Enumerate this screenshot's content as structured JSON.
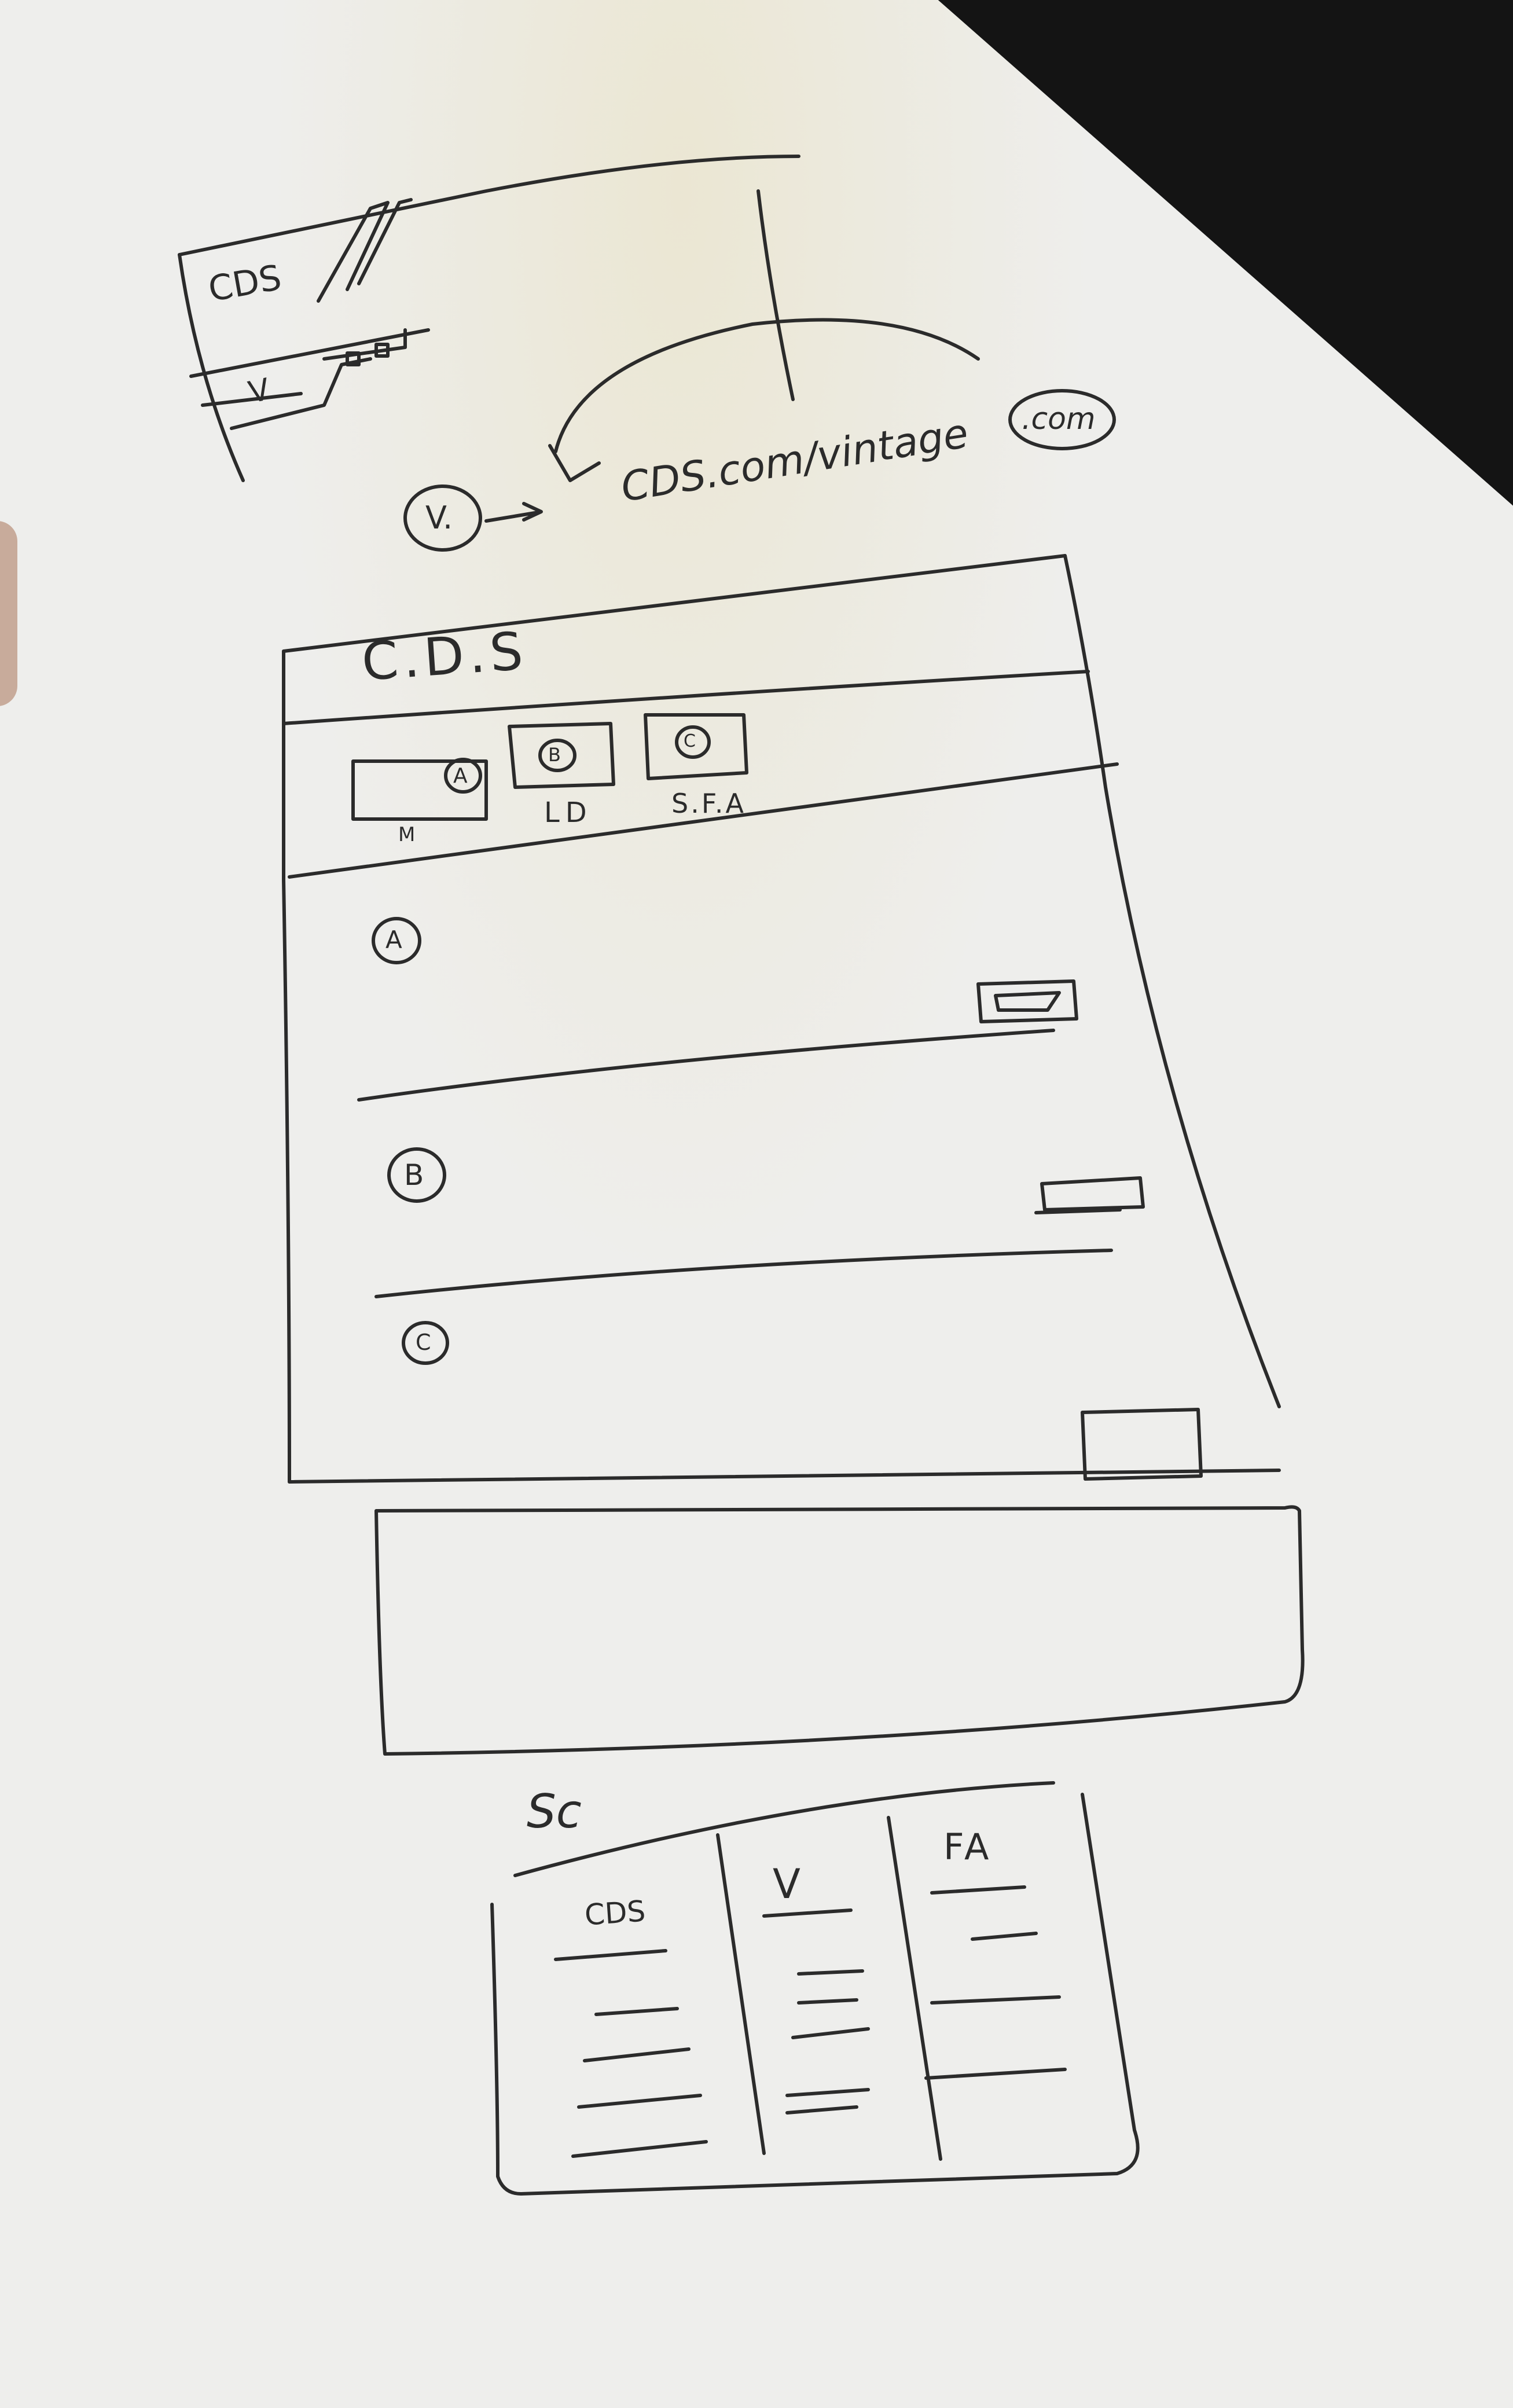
{
  "top_mockup": {
    "logo_text": "CDS",
    "nav_item": "V"
  },
  "url_annotation": {
    "marker": "V.",
    "arrow": "→",
    "url_text": "CDS.com/vintage",
    "domain_text": ".com"
  },
  "main_mockup": {
    "title": "C.D.S",
    "tabs": [
      {
        "badge": "A",
        "label": "M"
      },
      {
        "badge": "B",
        "label": "LD"
      },
      {
        "badge": "C",
        "label": "S.F.A"
      }
    ],
    "sections": [
      {
        "marker": "A"
      },
      {
        "marker": "B"
      },
      {
        "marker": "C"
      }
    ]
  },
  "bottom_table": {
    "title": "Sc",
    "columns": [
      "CDS",
      "V",
      "FA"
    ]
  }
}
